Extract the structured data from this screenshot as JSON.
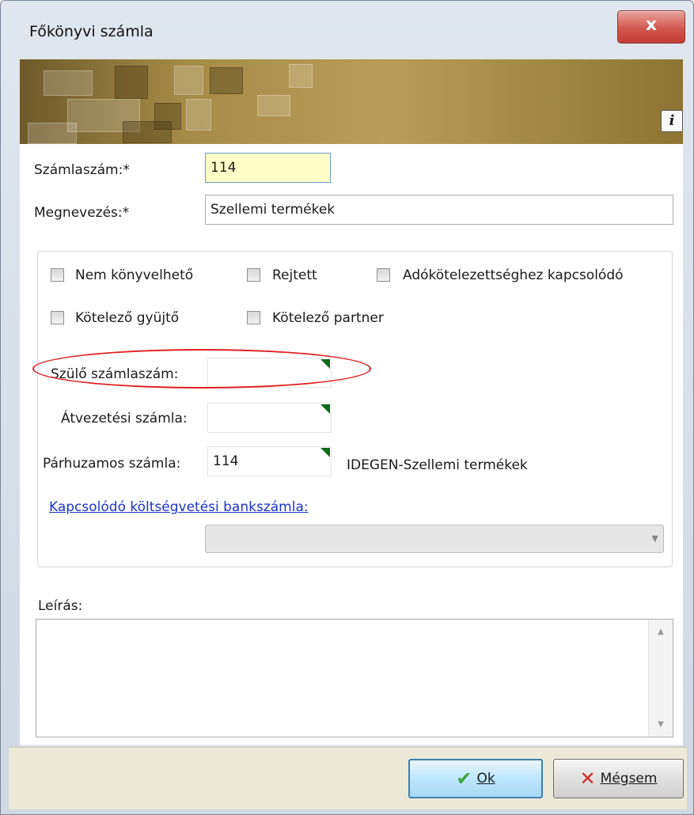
{
  "window": {
    "title": "Főkönyvi számla",
    "close_label": "x"
  },
  "form": {
    "account_number_label": "Számlaszám:*",
    "account_number_value": "114",
    "name_label": "Megnevezés:*",
    "name_value": "Szellemi termékek"
  },
  "options": {
    "not_bookable": "Nem könyvelhető",
    "hidden": "Rejtett",
    "tax_related": "Adókötelezettséghez kapcsolódó",
    "mandatory_collector": "Kötelező gyüjtő",
    "mandatory_partner": "Kötelező partner"
  },
  "links": {
    "parent_label": "Szülő számlaszám:",
    "parent_value": "",
    "transfer_label": "Átvezetési számla:",
    "transfer_value": "",
    "parallel_label": "Párhuzamos számla:",
    "parallel_value": "114",
    "parallel_desc": "IDEGEN-Szellemi termékek",
    "budget_link": "Kapcsolódó költségvetési bankszámla:",
    "budget_value": ""
  },
  "description": {
    "label": "Leírás:",
    "value": ""
  },
  "buttons": {
    "ok": "Ok",
    "cancel": "Mégsem"
  },
  "colors": {
    "link": "#1a36c8",
    "required_field_bg": "#ffffc8",
    "highlight": "#e02020",
    "close_button": "#c43d33"
  },
  "icons": {
    "info": "info-icon",
    "ok": "checkmark-icon",
    "cancel": "cross-icon",
    "dropdown": "chevron-down-icon"
  }
}
